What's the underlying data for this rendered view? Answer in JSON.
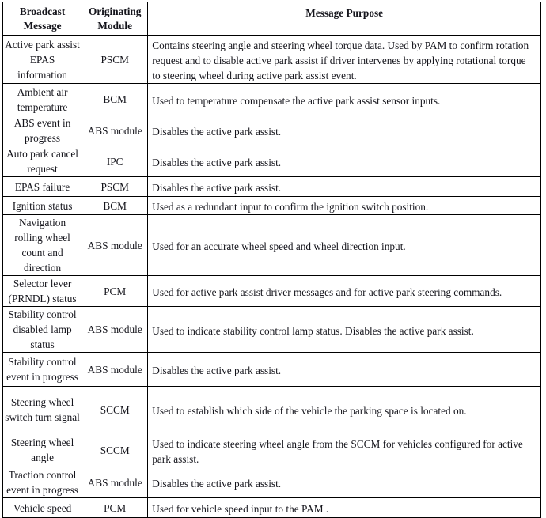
{
  "table": {
    "columns": [
      {
        "key": "broadcast",
        "label": "Broadcast\nMessage",
        "label_line1": "Broadcast",
        "label_line2": "Message"
      },
      {
        "key": "module",
        "label": "Originating\nModule",
        "label_line1": "Originating",
        "label_line2": "Module"
      },
      {
        "key": "purpose",
        "label": "Message Purpose"
      }
    ],
    "header": {
      "broadcast_line1": "Broadcast",
      "broadcast_line2": "Message",
      "module_line1": "Originating",
      "module_line2": "Module",
      "purpose": "Message Purpose"
    },
    "rows": [
      {
        "broadcast": "Active park assist EPAS information",
        "module": "PSCM",
        "purpose": "Contains steering angle and steering wheel torque data. Used by PAM to confirm rotation request and to disable active park assist if driver intervenes by applying rotational torque to steering wheel during active park assist event.",
        "height": 61
      },
      {
        "broadcast": "Ambient air temperature",
        "module": "BCM",
        "purpose": "Used to temperature compensate the active park assist sensor inputs.",
        "height": 40
      },
      {
        "broadcast": "ABS event in progress",
        "module": "ABS module",
        "purpose": "Disables the active park assist.",
        "height": 39
      },
      {
        "broadcast": "Auto park cancel request",
        "module": "IPC",
        "purpose": "Disables the active park assist.",
        "height": 37
      },
      {
        "broadcast": "EPAS failure",
        "module": "PSCM",
        "purpose": "Disables the active park assist.",
        "height": 25
      },
      {
        "broadcast": "Ignition status",
        "module": "BCM",
        "purpose": "Used as a redundant input to confirm the ignition switch position.",
        "height": 22
      },
      {
        "broadcast": "Navigation rolling wheel count and direction",
        "module": "ABS module",
        "purpose": "Used for an accurate wheel speed and wheel direction input.",
        "height": 72
      },
      {
        "broadcast": "Selector lever (PRNDL) status",
        "module": "PCM",
        "purpose": "Used for active park assist driver messages and for active park steering commands.",
        "height": 38
      },
      {
        "broadcast": "Stability control disabled lamp status",
        "module": "ABS module",
        "purpose": "Used to indicate stability control lamp status. Disables the active park assist.",
        "height": 54
      },
      {
        "broadcast": "Stability control event in progress",
        "module": "ABS module",
        "purpose": "Disables the active park assist.",
        "height": 43
      },
      {
        "broadcast": "Steering wheel switch turn signal",
        "module": "SCCM",
        "purpose": "Used to establish which side of the vehicle the parking space is located on.",
        "height": 59
      },
      {
        "broadcast": "Steering wheel angle",
        "module": "SCCM",
        "purpose": "Used to indicate steering wheel angle from the SCCM for vehicles configured for active park assist.",
        "height": 43
      },
      {
        "broadcast": "Traction control event in progress",
        "module": "ABS module",
        "purpose": "Disables the active park assist.",
        "height": 38
      },
      {
        "broadcast": "Vehicle speed",
        "module": "PCM",
        "purpose": "Used for vehicle speed input to the PAM .",
        "height": 25
      }
    ]
  },
  "colors": {
    "border": "#000000",
    "text": "#15151c",
    "background": "#ffffff"
  }
}
